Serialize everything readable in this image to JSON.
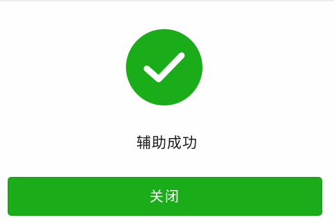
{
  "result": {
    "icon": "checkmark-icon",
    "status_text": "辅助成功"
  },
  "actions": {
    "close_label": "关闭"
  },
  "colors": {
    "success_green": "#1aad19",
    "text_dark": "#1b1b1b",
    "background": "#fefefe"
  }
}
